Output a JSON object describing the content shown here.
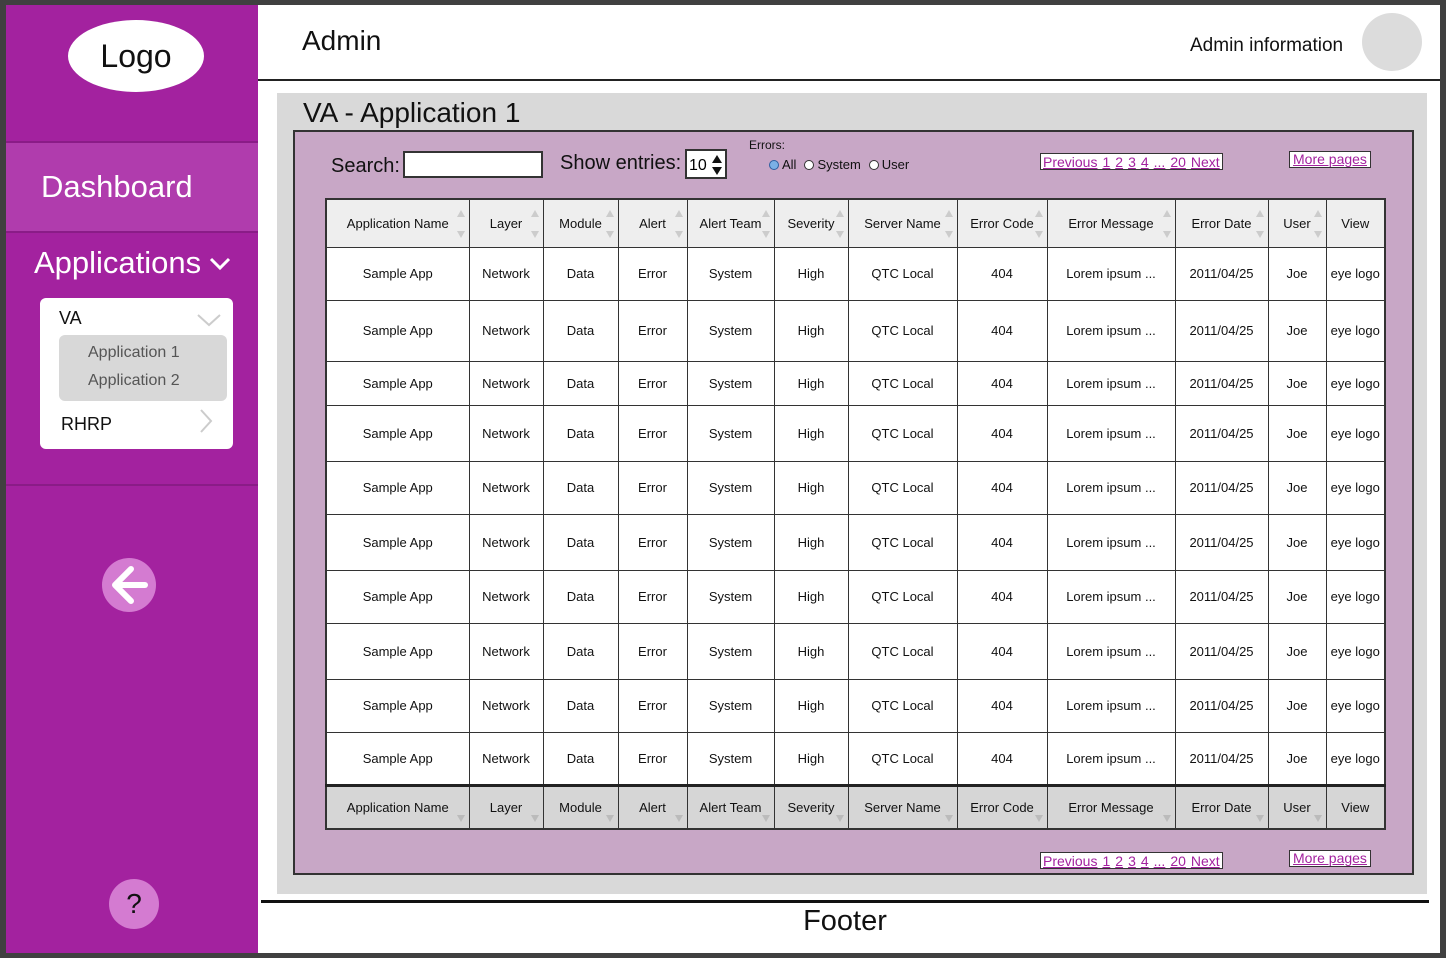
{
  "sidebar": {
    "logo": "Logo",
    "dashboard": "Dashboard",
    "applications": "Applications",
    "group": "VA",
    "sub_items": [
      "Application 1",
      "Application 2"
    ],
    "group2": "RHRP",
    "help": "?"
  },
  "header": {
    "title": "Admin",
    "admin_info": "Admin information"
  },
  "page": {
    "title": "VA - Application 1",
    "search_label": "Search:",
    "search_value": "",
    "entries_label": "Show entries:",
    "entries_value": "10",
    "errors_label": "Errors:",
    "filters": [
      "All",
      "System",
      "User"
    ],
    "selected_filter": "All",
    "pager": {
      "previous": "Previous",
      "pages": [
        "1",
        "2",
        "3",
        "4",
        "...",
        "20"
      ],
      "next": "Next",
      "more": "More pages"
    },
    "footer": "Footer"
  },
  "table": {
    "columns": [
      "Application Name",
      "Layer",
      "Module",
      "Alert",
      "Alert Team",
      "Severity",
      "Server Name",
      "Error Code",
      "Error Message",
      "Error Date",
      "User",
      "View"
    ],
    "rows": [
      [
        "Sample App",
        "Network",
        "Data",
        "Error",
        "System",
        "High",
        "QTC Local",
        "404",
        "Lorem ipsum ...",
        "2011/04/25",
        "Joe",
        "eye logo"
      ],
      [
        "Sample App",
        "Network",
        "Data",
        "Error",
        "System",
        "High",
        "QTC Local",
        "404",
        "Lorem ipsum ...",
        "2011/04/25",
        "Joe",
        "eye logo"
      ],
      [
        "Sample App",
        "Network",
        "Data",
        "Error",
        "System",
        "High",
        "QTC Local",
        "404",
        "Lorem ipsum ...",
        "2011/04/25",
        "Joe",
        "eye logo"
      ],
      [
        "Sample App",
        "Network",
        "Data",
        "Error",
        "System",
        "High",
        "QTC Local",
        "404",
        "Lorem ipsum ...",
        "2011/04/25",
        "Joe",
        "eye logo"
      ],
      [
        "Sample App",
        "Network",
        "Data",
        "Error",
        "System",
        "High",
        "QTC Local",
        "404",
        "Lorem ipsum ...",
        "2011/04/25",
        "Joe",
        "eye logo"
      ],
      [
        "Sample App",
        "Network",
        "Data",
        "Error",
        "System",
        "High",
        "QTC Local",
        "404",
        "Lorem ipsum ...",
        "2011/04/25",
        "Joe",
        "eye logo"
      ],
      [
        "Sample App",
        "Network",
        "Data",
        "Error",
        "System",
        "High",
        "QTC Local",
        "404",
        "Lorem ipsum ...",
        "2011/04/25",
        "Joe",
        "eye logo"
      ],
      [
        "Sample App",
        "Network",
        "Data",
        "Error",
        "System",
        "High",
        "QTC Local",
        "404",
        "Lorem ipsum ...",
        "2011/04/25",
        "Joe",
        "eye logo"
      ],
      [
        "Sample App",
        "Network",
        "Data",
        "Error",
        "System",
        "High",
        "QTC Local",
        "404",
        "Lorem ipsum ...",
        "2011/04/25",
        "Joe",
        "eye logo"
      ],
      [
        "Sample App",
        "Network",
        "Data",
        "Error",
        "System",
        "High",
        "QTC Local",
        "404",
        "Lorem ipsum ...",
        "2011/04/25",
        "Joe",
        "eye logo"
      ]
    ]
  },
  "colors": {
    "sidebar": "#a3229f",
    "dashboard_highlight": "#b03cad",
    "panel": "#c8a7c6",
    "link": "#a3229f"
  }
}
